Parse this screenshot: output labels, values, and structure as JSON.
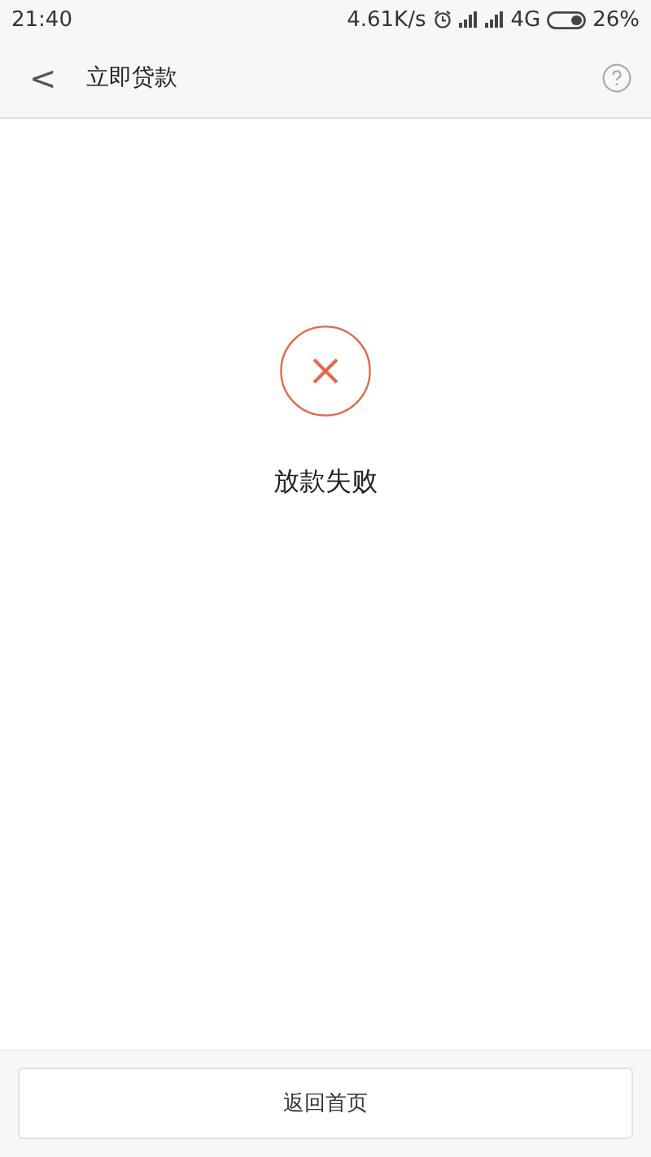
{
  "status_bar": {
    "time": "21:40",
    "speed": "4.61K/s",
    "network": "4G",
    "battery": "26%"
  },
  "header": {
    "back": "<",
    "title": "立即贷款"
  },
  "result": {
    "kind": "failure",
    "title": "放款失败"
  },
  "bottom_button": {
    "label": "返回首页"
  }
}
